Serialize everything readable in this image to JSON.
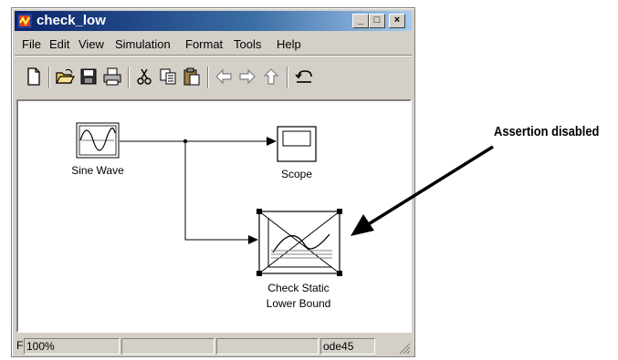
{
  "window": {
    "title": "check_low",
    "controls": {
      "minimize": "_",
      "maximize": "□",
      "close": "×"
    }
  },
  "menu": [
    "File",
    "Edit",
    "View",
    "Simulation",
    "Format",
    "Tools",
    "Help"
  ],
  "toolbar": {
    "icons": [
      "new-file-icon",
      "open-folder-icon",
      "save-icon",
      "print-icon",
      "cut-icon",
      "copy-icon",
      "paste-icon",
      "back-arrow-icon",
      "forward-arrow-icon",
      "up-arrow-icon",
      "undo-icon"
    ]
  },
  "blocks": {
    "sine_wave": "Sine Wave",
    "scope": "Scope",
    "check_static_line1": "Check Static",
    "check_static_line2": "Lower Bound"
  },
  "status": {
    "prefix": "F",
    "zoom": "100%",
    "cell2": "",
    "cell3": "",
    "solver": "ode45"
  },
  "annotation": "Assertion disabled",
  "colors": {
    "titlebar": "#0a246a",
    "chrome": "#d4d0c8"
  }
}
